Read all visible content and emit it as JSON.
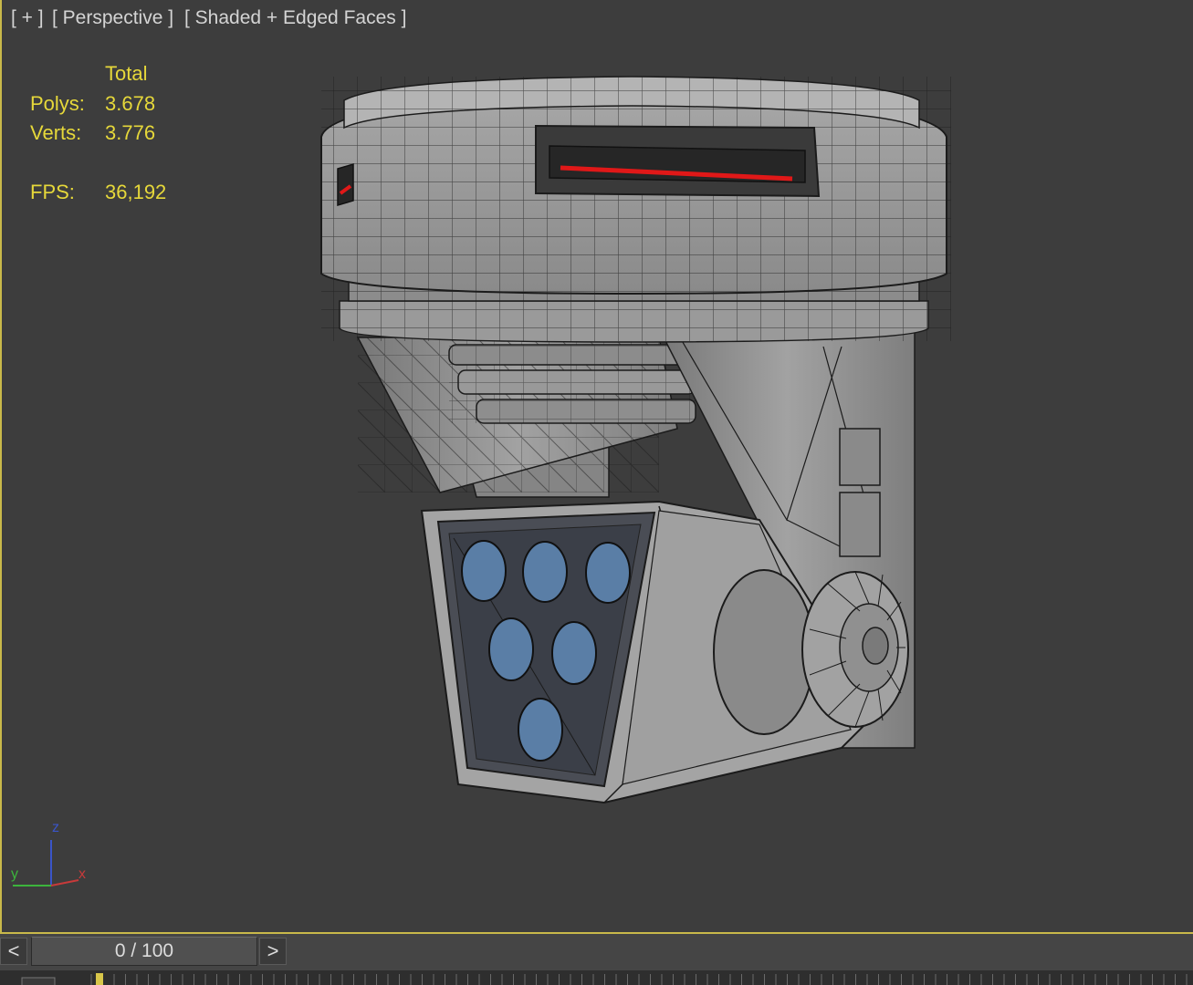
{
  "viewport": {
    "label_plus": "[ + ]",
    "label_view": "[ Perspective ]",
    "label_shading": "[ Shaded + Edged Faces ]"
  },
  "stats": {
    "header": "Total",
    "polys_label": "Polys:",
    "polys_value": "3.678",
    "verts_label": "Verts:",
    "verts_value": "3.776",
    "fps_label": "FPS:",
    "fps_value": "36,192"
  },
  "axis": {
    "z": "z",
    "y": "y",
    "x": "x"
  },
  "timeline": {
    "prev": "<",
    "next": ">",
    "frame_display": "0 / 100"
  },
  "colors": {
    "viewport_bg": "#3d3d3d",
    "stats_text": "#e6d83a",
    "active_border": "#c9b94a",
    "model_surface": "#8c8c8c",
    "lens_blue": "#5a7ea6",
    "light_strip_red": "#e01818"
  }
}
